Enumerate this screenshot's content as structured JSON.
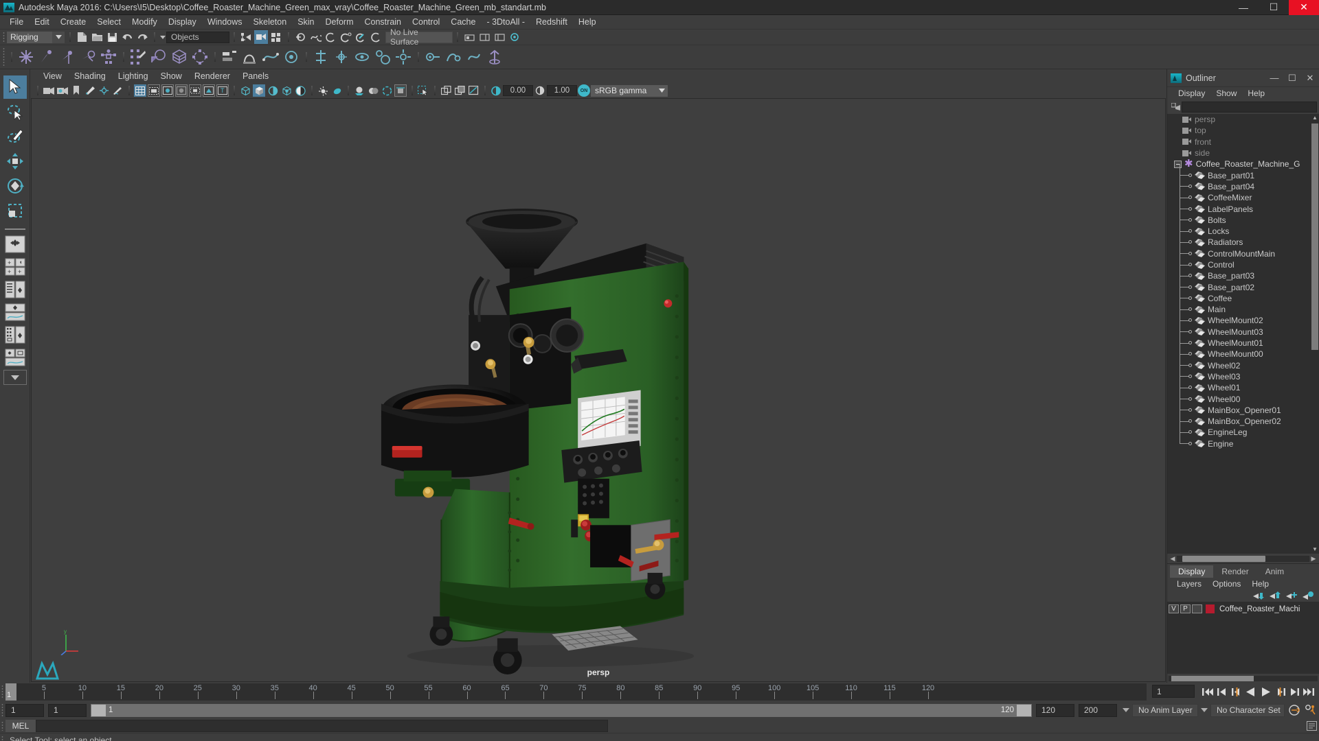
{
  "window": {
    "title": "Autodesk Maya 2016: C:\\Users\\I5\\Desktop\\Coffee_Roaster_Machine_Green_max_vray\\Coffee_Roaster_Machine_Green_mb_standart.mb",
    "minimize": "—",
    "maximize": "☐",
    "close": "✕"
  },
  "menubar": {
    "items": [
      "File",
      "Edit",
      "Create",
      "Select",
      "Modify",
      "Display",
      "Windows",
      "Skeleton",
      "Skin",
      "Deform",
      "Constrain",
      "Control",
      "Cache",
      "- 3DtoAll -",
      "Redshift",
      "Help"
    ]
  },
  "statusline": {
    "menuset": "Rigging",
    "selection_mask": "Objects",
    "live_surface": "No Live Surface"
  },
  "viewport_menu": {
    "items": [
      "View",
      "Shading",
      "Lighting",
      "Show",
      "Renderer",
      "Panels"
    ]
  },
  "viewport_toolbar": {
    "exposure": "0.00",
    "gamma": "1.00",
    "color_profile": "sRGB gamma",
    "toggle_label": "ON"
  },
  "viewport": {
    "camera_label": "persp",
    "axis_y": "y",
    "axis_x": "x",
    "axis_z": "z"
  },
  "outliner": {
    "title": "Outliner",
    "menus": [
      "Display",
      "Show",
      "Help"
    ],
    "cameras": [
      "persp",
      "top",
      "front",
      "side"
    ],
    "group": "Coffee_Roaster_Machine_G",
    "children": [
      "Base_part01",
      "Base_part04",
      "CoffeeMixer",
      "LabelPanels",
      "Bolts",
      "Locks",
      "Radiators",
      "ControlMountMain",
      "Control",
      "Base_part03",
      "Base_part02",
      "Coffee",
      "Main",
      "WheelMount02",
      "WheelMount03",
      "WheelMount01",
      "WheelMount00",
      "Wheel02",
      "Wheel03",
      "Wheel01",
      "Wheel00",
      "MainBox_Opener01",
      "MainBox_Opener02",
      "EngineLeg",
      "Engine"
    ]
  },
  "layer_editor": {
    "tabs": [
      "Display",
      "Render",
      "Anim"
    ],
    "active_tab": "Display",
    "menus": [
      "Layers",
      "Options",
      "Help"
    ],
    "columns": [
      "V",
      "P"
    ],
    "layers": [
      {
        "visible": "V",
        "playback": "P",
        "shading": "",
        "color": "#b51b2e",
        "name": "Coffee_Roaster_Machi"
      }
    ]
  },
  "timeline": {
    "current_frame": "1",
    "ticks": [
      5,
      10,
      15,
      20,
      25,
      30,
      35,
      40,
      45,
      50,
      55,
      60,
      65,
      70,
      75,
      80,
      85,
      90,
      95,
      100,
      105,
      110,
      115,
      120
    ],
    "frame_field": "1",
    "range_start": "1",
    "range_end": "1",
    "anim_end": "120",
    "playback_end": "200",
    "range_slider_left": "1",
    "range_slider_right": "120",
    "anim_layer": "No Anim Layer",
    "character_set": "No Character Set"
  },
  "command_line": {
    "language": "MEL",
    "input": ""
  },
  "help_line": {
    "text": "Select Tool: select an object"
  },
  "colors": {
    "accent_blue": "#4c7e9e",
    "panel_bg": "#3d3d3d",
    "dark_bg": "#2e2e2e",
    "close_red": "#e81123",
    "machine_green": "#2f6b2a",
    "machine_dark": "#1a1a1a"
  }
}
